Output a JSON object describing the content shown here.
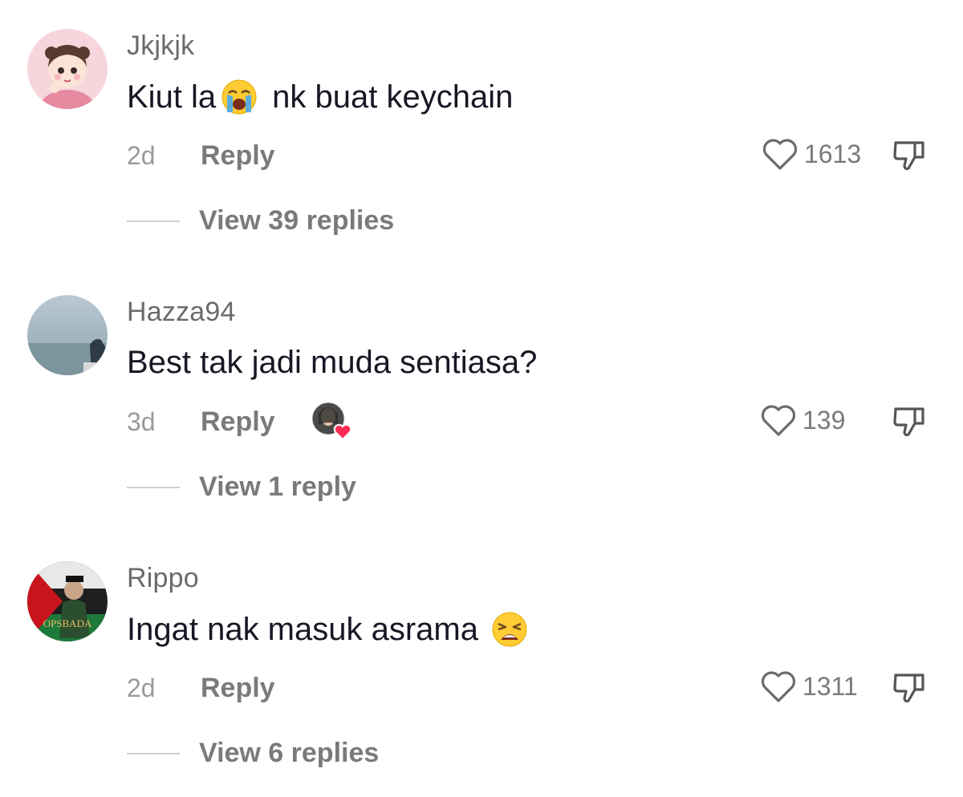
{
  "comments": [
    {
      "username": "Jkjkjk",
      "text_before": "Kiut la",
      "emoji": "loudly-crying-face",
      "text_after": "nk buat keychain",
      "time": "2d",
      "reply_label": "Reply",
      "likes": "1613",
      "view_replies": "View 39 replies",
      "creator_liked": false
    },
    {
      "username": "Hazza94",
      "text_before": "Best tak jadi muda sentiasa?",
      "emoji": "",
      "text_after": "",
      "time": "3d",
      "reply_label": "Reply",
      "likes": "139",
      "view_replies": "View 1 reply",
      "creator_liked": true
    },
    {
      "username": "Rippo",
      "text_before": "Ingat nak masuk asrama",
      "emoji": "weary-face",
      "text_after": "",
      "time": "2d",
      "reply_label": "Reply",
      "likes": "1311",
      "view_replies": "View 6 replies",
      "creator_liked": false
    }
  ],
  "avatar_3_text": "OPSBADA",
  "colors": {
    "username": "#6b6b6b",
    "comment_text": "#161823",
    "meta": "#7a7a7a",
    "heart_badge": "#fe2c55"
  }
}
